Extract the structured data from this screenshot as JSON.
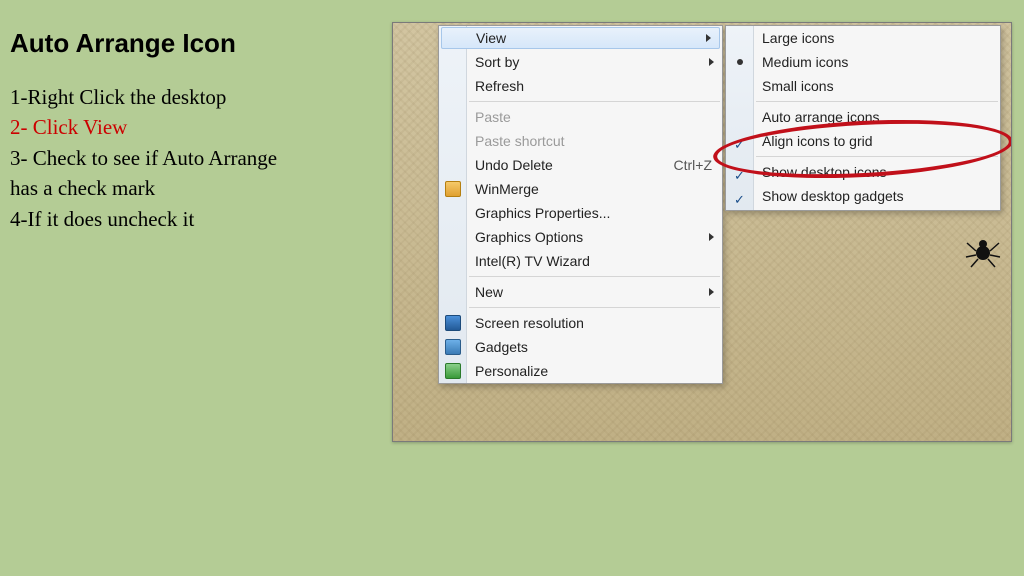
{
  "title": "Auto Arrange Icon",
  "steps": {
    "s1": "1-Right Click the desktop",
    "s2": "2- Click View",
    "s3a": "3- Check to see if Auto Arrange",
    "s3b": " has a check mark",
    "s4": "4-If it does uncheck it"
  },
  "context_menu": {
    "view": "View",
    "sort_by": "Sort by",
    "refresh": "Refresh",
    "paste": "Paste",
    "paste_shortcut": "Paste shortcut",
    "undo_delete": "Undo Delete",
    "undo_delete_shortcut": "Ctrl+Z",
    "winmerge": "WinMerge",
    "graphics_properties": "Graphics Properties...",
    "graphics_options": "Graphics Options",
    "intel_tv": "Intel(R) TV Wizard",
    "new": "New",
    "screen_resolution": "Screen resolution",
    "gadgets": "Gadgets",
    "personalize": "Personalize"
  },
  "submenu": {
    "large_icons": "Large icons",
    "medium_icons": "Medium icons",
    "small_icons": "Small icons",
    "auto_arrange": "Auto arrange icons",
    "align_grid": "Align icons to grid",
    "show_desktop_icons": "Show desktop icons",
    "show_desktop_gadgets": "Show desktop gadgets"
  }
}
